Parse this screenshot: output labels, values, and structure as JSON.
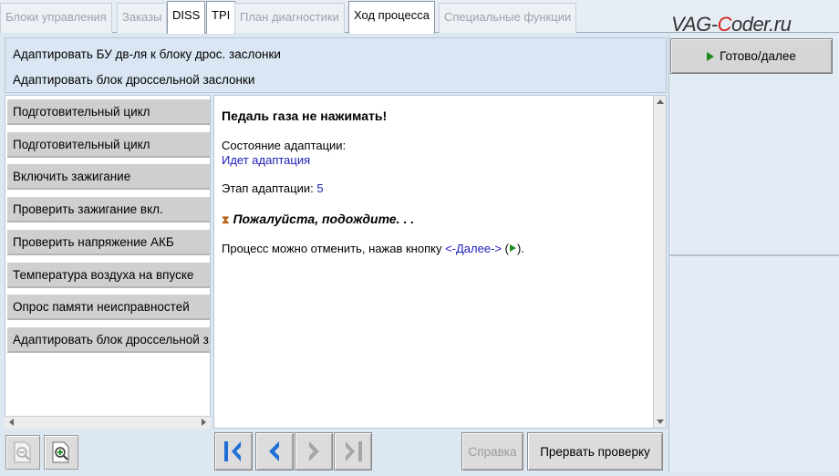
{
  "tabs": [
    {
      "label": "Блоки управления",
      "state": "disabled"
    },
    {
      "label": "Заказы",
      "state": "disabled"
    },
    {
      "label": "DISS",
      "state": "active"
    },
    {
      "label": "TPI",
      "state": "active"
    },
    {
      "label": "План диагностики",
      "state": "disabled"
    },
    {
      "label": "Ход процесса",
      "state": "active"
    },
    {
      "label": "Специальные функции",
      "state": "disabled"
    }
  ],
  "logo": {
    "prefix": "VAG-",
    "highlight": "C",
    "suffix": "oder.ru"
  },
  "header": {
    "line1": "Адаптировать БУ дв-ля к блоку дрос. заслонки",
    "line2": "Адаптировать блок дроссельной заслонки"
  },
  "next_button": {
    "label": "Готово/далее",
    "icon": "play-icon"
  },
  "steps": [
    "Подготовительный цикл",
    "Подготовительный цикл",
    "Включить зажигание",
    "Проверить зажигание вкл.",
    "Проверить напряжение АКБ",
    "Температура воздуха на впуске",
    "Опрос памяти неисправностей",
    "Адаптировать блок дроссельной з"
  ],
  "content": {
    "heading": "Педаль газа не нажимать!",
    "status_label": "Состояние адаптации:",
    "status_value": "Идет адаптация",
    "stage_label": "Этап адаптации: ",
    "stage_value": "5",
    "wait_text": "Пожалуйста, подождите. . .",
    "cancel_prefix": "Процесс можно отменить, нажав кнопку ",
    "cancel_link": "<-Далее->",
    "cancel_open": " (",
    "cancel_close": ")."
  },
  "toolbar": {
    "help_label": "Справка",
    "abort_label": "Прервать проверку"
  },
  "colors": {
    "accent_blue": "#1a1ab8",
    "play_green": "#1f8a1f",
    "nav_blue": "#1f6fd6",
    "nav_disabled": "#a5a5a5"
  }
}
